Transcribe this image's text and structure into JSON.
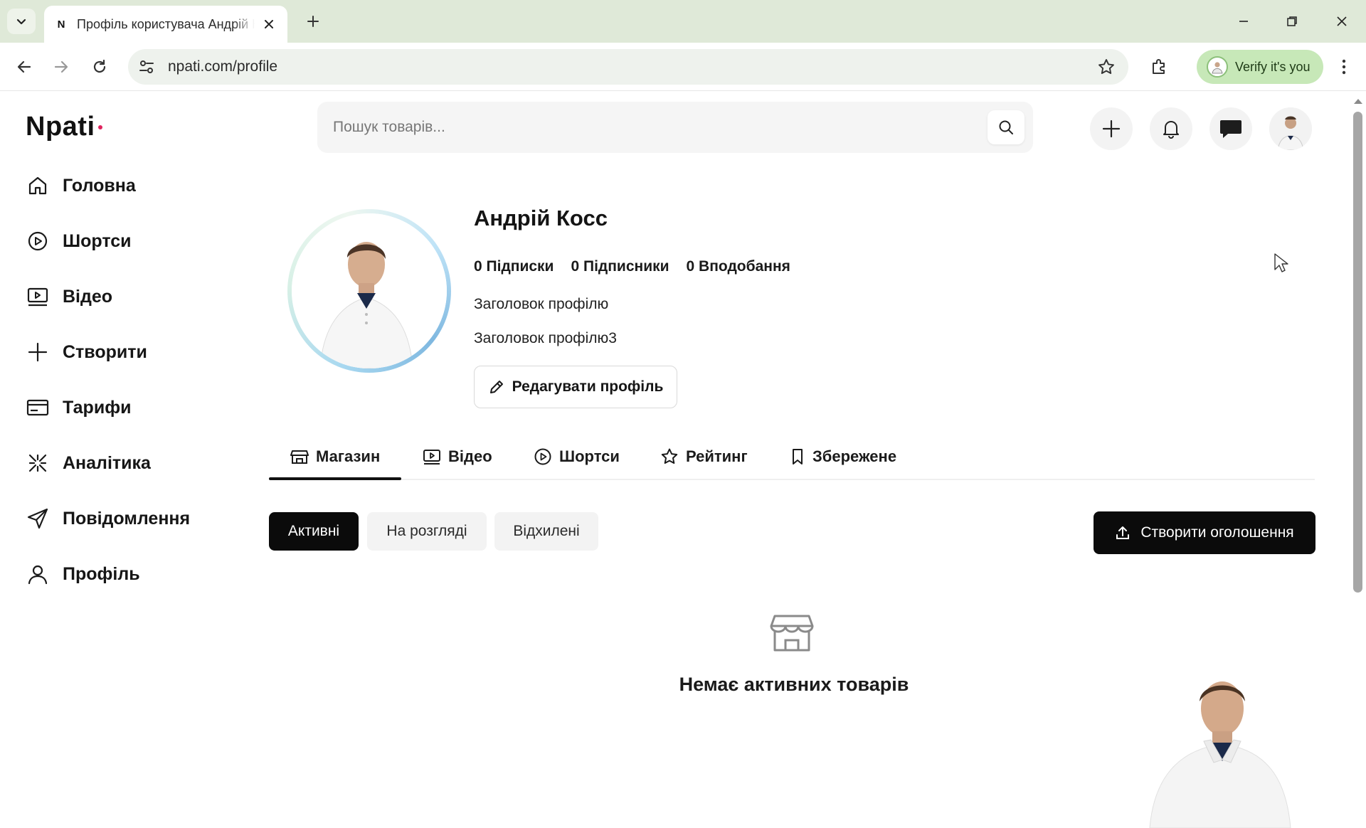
{
  "browser": {
    "tab_title": "Профіль користувача Андрій Косс",
    "tab_favicon": "N",
    "url": "npati.com/profile",
    "verify_label": "Verify it's you"
  },
  "app": {
    "logo": "Npati",
    "search_placeholder": "Пошук товарів..."
  },
  "sidebar": {
    "items": [
      {
        "label": "Головна",
        "icon": "home-icon"
      },
      {
        "label": "Шортси",
        "icon": "play-circle-icon"
      },
      {
        "label": "Відео",
        "icon": "video-icon"
      },
      {
        "label": "Створити",
        "icon": "plus-icon"
      },
      {
        "label": "Тарифи",
        "icon": "card-icon"
      },
      {
        "label": "Аналітика",
        "icon": "analytics-icon"
      },
      {
        "label": "Повідомлення",
        "icon": "send-icon"
      },
      {
        "label": "Профіль",
        "icon": "user-icon"
      }
    ]
  },
  "profile": {
    "name": "Андрій Косс",
    "following": "0 Підписки",
    "followers": "0 Підписники",
    "likes": "0 Вподобання",
    "headline1": "Заголовок профілю",
    "headline2": "Заголовок профілю3",
    "edit_label": "Редагувати профіль"
  },
  "tabs": [
    {
      "label": "Магазин",
      "icon": "store-icon",
      "active": true
    },
    {
      "label": "Відео",
      "icon": "video-icon"
    },
    {
      "label": "Шортси",
      "icon": "play-circle-icon"
    },
    {
      "label": "Рейтинг",
      "icon": "star-icon"
    },
    {
      "label": "Збережене",
      "icon": "bookmark-icon"
    }
  ],
  "filters": {
    "active": "Активні",
    "review": "На розгляді",
    "rejected": "Відхилені"
  },
  "create_ad_label": "Створити оголошення",
  "empty_state": "Немає активних товарів",
  "colors": {
    "tabbar_bg": "#dfe9d8",
    "verify_bg": "#c7e8b8",
    "primary": "#0b0b0b",
    "logo_dot": "#e0245e"
  }
}
